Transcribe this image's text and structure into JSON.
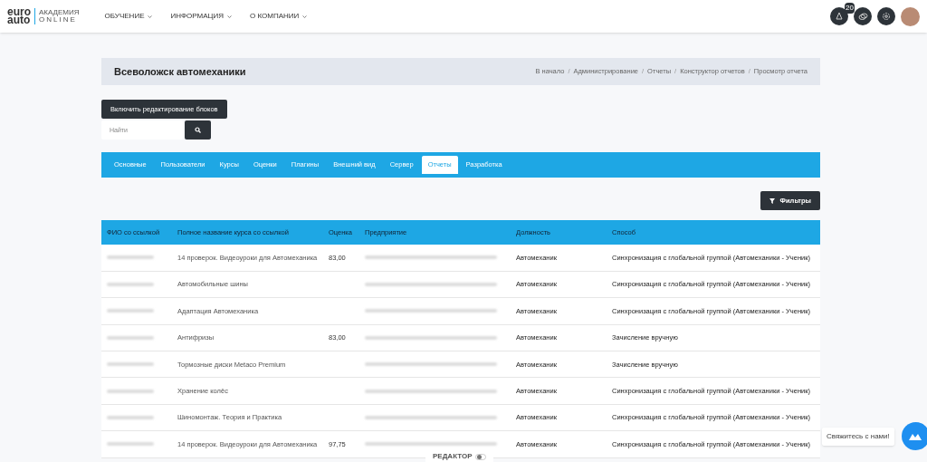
{
  "header": {
    "logo": {
      "brand_top": "euro",
      "brand_bottom": "auto",
      "sub_top": "АКАДЕМИЯ",
      "sub_bottom": "ONLINE"
    },
    "nav": [
      "ОБУЧЕНИЕ",
      "ИНФОРМАЦИЯ",
      "О КОМПАНИИ"
    ],
    "notification_badge": "20"
  },
  "page_title": "Всеволожск автомеханики",
  "breadcrumb_separator": "/",
  "breadcrumbs": [
    "В начало",
    "Администрирование",
    "Отчеты",
    "Конструктор отчетов",
    "Просмотр отчета"
  ],
  "edit_blocks_button": "Включить редактирование блоков",
  "search": {
    "placeholder": "Найти"
  },
  "tabs": [
    {
      "label": "Основные",
      "selected": false
    },
    {
      "label": "Пользователи",
      "selected": false
    },
    {
      "label": "Курсы",
      "selected": false
    },
    {
      "label": "Оценки",
      "selected": false
    },
    {
      "label": "Плагины",
      "selected": false
    },
    {
      "label": "Внешний вид",
      "selected": false
    },
    {
      "label": "Сервер",
      "selected": false
    },
    {
      "label": "Отчеты",
      "selected": true
    },
    {
      "label": "Разработка",
      "selected": false
    }
  ],
  "filters_button": "Фильтры",
  "table": {
    "columns": [
      "ФИО со ссылкой",
      "Полное название курса со ссылкой",
      "Оценка",
      "Предприятие",
      "Должность",
      "Способ"
    ],
    "rows": [
      {
        "course": "14 проверок. Видеоуроки для Автомеханика",
        "grade": "83,00",
        "position": "Автомеханик",
        "method": "Синхронизация с глобальной группой (Автомеханики - Ученик)"
      },
      {
        "course": "Автомобильные шины",
        "grade": "",
        "position": "Автомеханик",
        "method": "Синхронизация с глобальной группой (Автомеханики - Ученик)"
      },
      {
        "course": "Адаптация Автомеханика",
        "grade": "",
        "position": "Автомеханик",
        "method": "Синхронизация с глобальной группой (Автомеханики - Ученик)"
      },
      {
        "course": "Антифризы",
        "grade": "83,00",
        "position": "Автомеханик",
        "method": "Зачисление вручную"
      },
      {
        "course": "Тормозные диски Metaco Premium",
        "grade": "",
        "position": "Автомеханик",
        "method": "Зачисление вручную"
      },
      {
        "course": "Хранение колёс",
        "grade": "",
        "position": "Автомеханик",
        "method": "Синхронизация с глобальной группой (Автомеханики - Ученик)"
      },
      {
        "course": "Шиномонтаж. Теория и Практика",
        "grade": "",
        "position": "Автомеханик",
        "method": "Синхронизация с глобальной группой (Автомеханики - Ученик)"
      },
      {
        "course": "14 проверок. Видеоуроки для Автомеханика",
        "grade": "97,75",
        "position": "Автомеханик",
        "method": "Синхронизация с глобальной группой (Автомеханики - Ученик)"
      }
    ]
  },
  "editor_toggle": {
    "label": "РЕДАКТОР",
    "on": false
  },
  "contact_tooltip": "Свяжитесь с нами!"
}
